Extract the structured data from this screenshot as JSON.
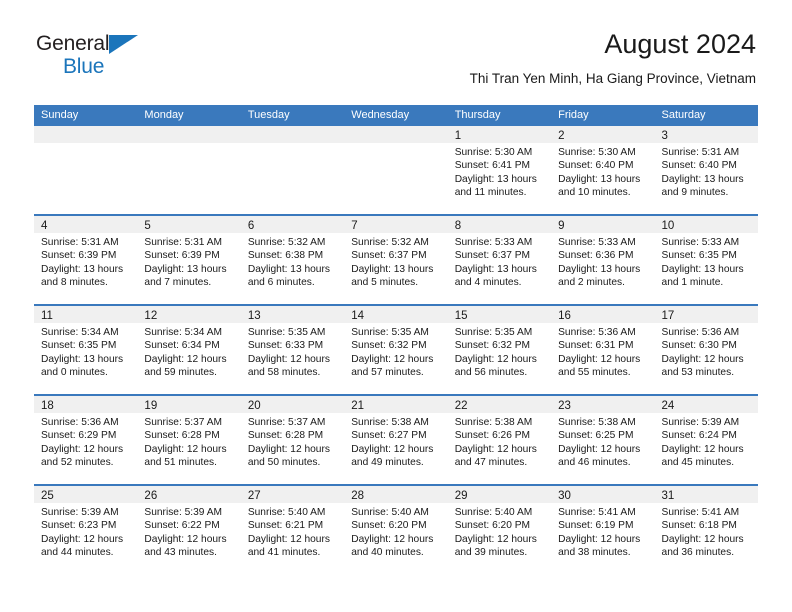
{
  "brand": {
    "name_part1": "General",
    "name_part2": "Blue",
    "triangle_icon": "triangle-icon",
    "colors": {
      "dark": "#231f20",
      "blue": "#1b75bb"
    }
  },
  "header": {
    "title": "August 2024",
    "subtitle": "Thi Tran Yen Minh, Ha Giang Province, Vietnam"
  },
  "theme": {
    "header_bg": "#3a79bd",
    "header_text": "#ffffff",
    "day_band_bg": "#f0f0f0",
    "cell_bg": "#ffffff",
    "text": "#1a1a1a"
  },
  "calendar": {
    "weekday_headers": [
      "Sunday",
      "Monday",
      "Tuesday",
      "Wednesday",
      "Thursday",
      "Friday",
      "Saturday"
    ],
    "weeks": [
      [
        {
          "day": "",
          "lines": []
        },
        {
          "day": "",
          "lines": []
        },
        {
          "day": "",
          "lines": []
        },
        {
          "day": "",
          "lines": []
        },
        {
          "day": "1",
          "lines": [
            "Sunrise: 5:30 AM",
            "Sunset: 6:41 PM",
            "Daylight: 13 hours",
            "and 11 minutes."
          ]
        },
        {
          "day": "2",
          "lines": [
            "Sunrise: 5:30 AM",
            "Sunset: 6:40 PM",
            "Daylight: 13 hours",
            "and 10 minutes."
          ]
        },
        {
          "day": "3",
          "lines": [
            "Sunrise: 5:31 AM",
            "Sunset: 6:40 PM",
            "Daylight: 13 hours",
            "and 9 minutes."
          ]
        }
      ],
      [
        {
          "day": "4",
          "lines": [
            "Sunrise: 5:31 AM",
            "Sunset: 6:39 PM",
            "Daylight: 13 hours",
            "and 8 minutes."
          ]
        },
        {
          "day": "5",
          "lines": [
            "Sunrise: 5:31 AM",
            "Sunset: 6:39 PM",
            "Daylight: 13 hours",
            "and 7 minutes."
          ]
        },
        {
          "day": "6",
          "lines": [
            "Sunrise: 5:32 AM",
            "Sunset: 6:38 PM",
            "Daylight: 13 hours",
            "and 6 minutes."
          ]
        },
        {
          "day": "7",
          "lines": [
            "Sunrise: 5:32 AM",
            "Sunset: 6:37 PM",
            "Daylight: 13 hours",
            "and 5 minutes."
          ]
        },
        {
          "day": "8",
          "lines": [
            "Sunrise: 5:33 AM",
            "Sunset: 6:37 PM",
            "Daylight: 13 hours",
            "and 4 minutes."
          ]
        },
        {
          "day": "9",
          "lines": [
            "Sunrise: 5:33 AM",
            "Sunset: 6:36 PM",
            "Daylight: 13 hours",
            "and 2 minutes."
          ]
        },
        {
          "day": "10",
          "lines": [
            "Sunrise: 5:33 AM",
            "Sunset: 6:35 PM",
            "Daylight: 13 hours",
            "and 1 minute."
          ]
        }
      ],
      [
        {
          "day": "11",
          "lines": [
            "Sunrise: 5:34 AM",
            "Sunset: 6:35 PM",
            "Daylight: 13 hours",
            "and 0 minutes."
          ]
        },
        {
          "day": "12",
          "lines": [
            "Sunrise: 5:34 AM",
            "Sunset: 6:34 PM",
            "Daylight: 12 hours",
            "and 59 minutes."
          ]
        },
        {
          "day": "13",
          "lines": [
            "Sunrise: 5:35 AM",
            "Sunset: 6:33 PM",
            "Daylight: 12 hours",
            "and 58 minutes."
          ]
        },
        {
          "day": "14",
          "lines": [
            "Sunrise: 5:35 AM",
            "Sunset: 6:32 PM",
            "Daylight: 12 hours",
            "and 57 minutes."
          ]
        },
        {
          "day": "15",
          "lines": [
            "Sunrise: 5:35 AM",
            "Sunset: 6:32 PM",
            "Daylight: 12 hours",
            "and 56 minutes."
          ]
        },
        {
          "day": "16",
          "lines": [
            "Sunrise: 5:36 AM",
            "Sunset: 6:31 PM",
            "Daylight: 12 hours",
            "and 55 minutes."
          ]
        },
        {
          "day": "17",
          "lines": [
            "Sunrise: 5:36 AM",
            "Sunset: 6:30 PM",
            "Daylight: 12 hours",
            "and 53 minutes."
          ]
        }
      ],
      [
        {
          "day": "18",
          "lines": [
            "Sunrise: 5:36 AM",
            "Sunset: 6:29 PM",
            "Daylight: 12 hours",
            "and 52 minutes."
          ]
        },
        {
          "day": "19",
          "lines": [
            "Sunrise: 5:37 AM",
            "Sunset: 6:28 PM",
            "Daylight: 12 hours",
            "and 51 minutes."
          ]
        },
        {
          "day": "20",
          "lines": [
            "Sunrise: 5:37 AM",
            "Sunset: 6:28 PM",
            "Daylight: 12 hours",
            "and 50 minutes."
          ]
        },
        {
          "day": "21",
          "lines": [
            "Sunrise: 5:38 AM",
            "Sunset: 6:27 PM",
            "Daylight: 12 hours",
            "and 49 minutes."
          ]
        },
        {
          "day": "22",
          "lines": [
            "Sunrise: 5:38 AM",
            "Sunset: 6:26 PM",
            "Daylight: 12 hours",
            "and 47 minutes."
          ]
        },
        {
          "day": "23",
          "lines": [
            "Sunrise: 5:38 AM",
            "Sunset: 6:25 PM",
            "Daylight: 12 hours",
            "and 46 minutes."
          ]
        },
        {
          "day": "24",
          "lines": [
            "Sunrise: 5:39 AM",
            "Sunset: 6:24 PM",
            "Daylight: 12 hours",
            "and 45 minutes."
          ]
        }
      ],
      [
        {
          "day": "25",
          "lines": [
            "Sunrise: 5:39 AM",
            "Sunset: 6:23 PM",
            "Daylight: 12 hours",
            "and 44 minutes."
          ]
        },
        {
          "day": "26",
          "lines": [
            "Sunrise: 5:39 AM",
            "Sunset: 6:22 PM",
            "Daylight: 12 hours",
            "and 43 minutes."
          ]
        },
        {
          "day": "27",
          "lines": [
            "Sunrise: 5:40 AM",
            "Sunset: 6:21 PM",
            "Daylight: 12 hours",
            "and 41 minutes."
          ]
        },
        {
          "day": "28",
          "lines": [
            "Sunrise: 5:40 AM",
            "Sunset: 6:20 PM",
            "Daylight: 12 hours",
            "and 40 minutes."
          ]
        },
        {
          "day": "29",
          "lines": [
            "Sunrise: 5:40 AM",
            "Sunset: 6:20 PM",
            "Daylight: 12 hours",
            "and 39 minutes."
          ]
        },
        {
          "day": "30",
          "lines": [
            "Sunrise: 5:41 AM",
            "Sunset: 6:19 PM",
            "Daylight: 12 hours",
            "and 38 minutes."
          ]
        },
        {
          "day": "31",
          "lines": [
            "Sunrise: 5:41 AM",
            "Sunset: 6:18 PM",
            "Daylight: 12 hours",
            "and 36 minutes."
          ]
        }
      ]
    ]
  }
}
